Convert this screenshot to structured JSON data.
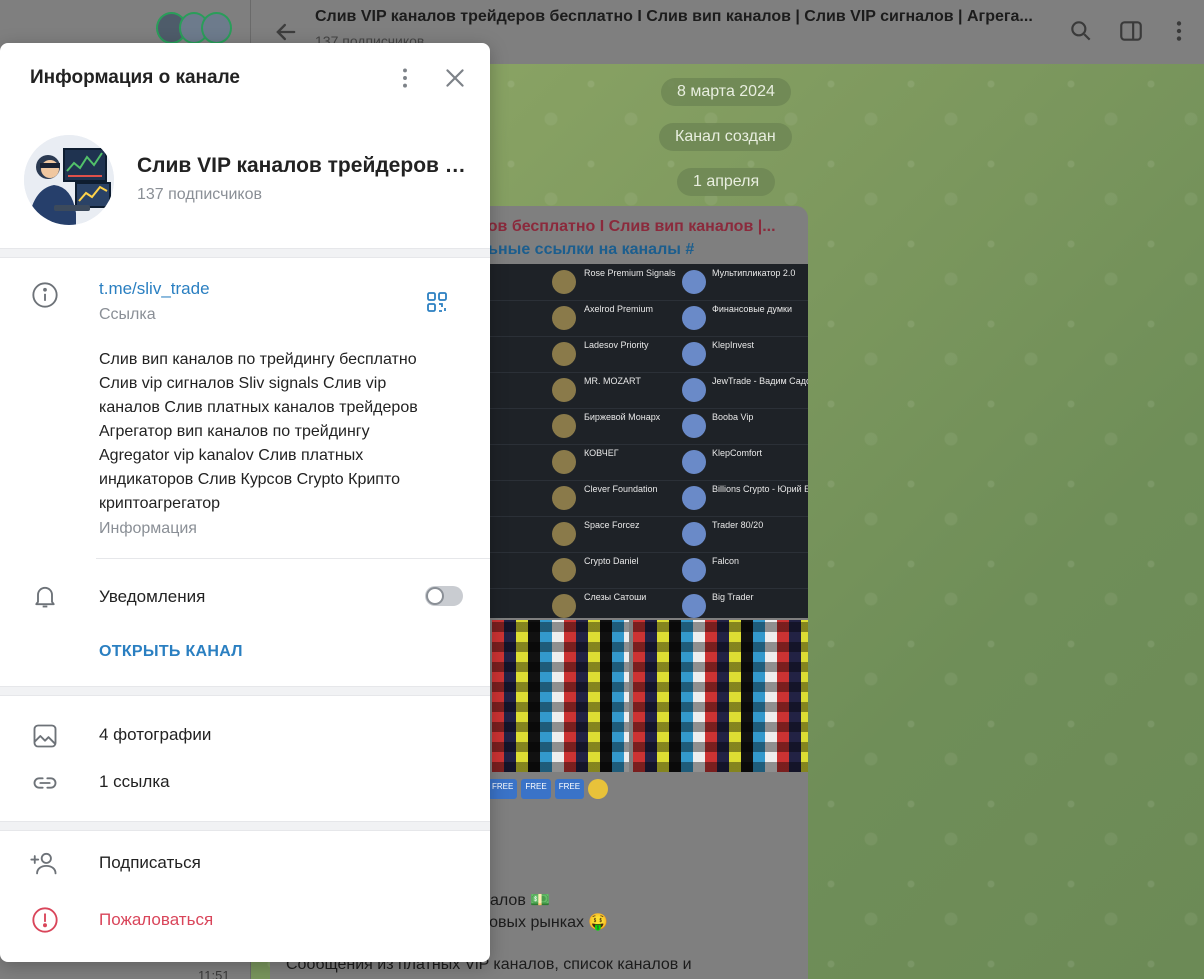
{
  "chat": {
    "title": "Слив VIP каналов трейдеров бесплатно I Слив вип каналов | Слив VIP сигналов | Агрега...",
    "subtitle": "137 подписчиков",
    "dates": [
      "8 марта 2024",
      "Канал создан",
      "1 апреля"
    ],
    "message": {
      "header_line1": "ров бесплатно I Слив вип каналов |...",
      "header_line2": "льные ссылки на каналы #",
      "tags": [
        "FREE",
        "FREE",
        "FREE"
      ],
      "lines": [
        "алов 💵",
        "товых рынках 🤑",
        "Сообщения из платных ViP каналов, список каналов и"
      ]
    },
    "screenshot_rows": [
      {
        "left": "Rose Premium Signals",
        "right": "Мультипликатор 2.0"
      },
      {
        "left": "Axelrod Premium",
        "right": "Финансовые думки"
      },
      {
        "left": "Ladesov Priority",
        "right": "KlepInvest"
      },
      {
        "left": "MR. MOZART",
        "right": "JewTrade - Вадим Садо"
      },
      {
        "left": "Биржевой Монарх",
        "right": "Booba Vip"
      },
      {
        "left": "КОВЧЕГ",
        "right": "KlepComfort"
      },
      {
        "left": "Clever Foundation",
        "right": "Billions Crypto - Юрий Б"
      },
      {
        "left": "Space Forcez",
        "right": "Trader 80/20"
      },
      {
        "left": "Crypto Daniel",
        "right": "Falcon"
      },
      {
        "left": "Слезы Сатоши",
        "right": "Big Trader"
      }
    ],
    "left_time": "11:51"
  },
  "dialog": {
    "title": "Информация о канале",
    "channel_name": "Слив VIP каналов трейдеров б...",
    "subscribers": "137 подписчиков",
    "link": "t.me/sliv_trade",
    "link_caption": "Ссылка",
    "description": "Слив вип каналов по трейдингу бесплатно\nСлив vip сигналов Sliv signals Слив vip\nканалов Слив платных каналов трейдеров\nАгрегатор вип каналов по трейдингу\nAgregator vip  kanalov Слив платных\nиндикаторов Слив Курсов Crypto Крипто\nкриптоагрегатор",
    "description_caption": "Информация",
    "notifications_label": "Уведомления",
    "notifications_enabled": false,
    "open_channel_label": "ОТКРЫТЬ КАНАЛ",
    "photos_label": "4 фотографии",
    "links_label": "1 ссылка",
    "subscribe_label": "Подписаться",
    "report_label": "Пожаловаться"
  },
  "colors": {
    "accent": "#2a7fc1",
    "danger": "#d9455a",
    "muted_text": "#8a8f96"
  },
  "icons": [
    "back-arrow-icon",
    "search-icon",
    "side-panel-icon",
    "more-vertical-icon",
    "close-icon",
    "info-icon",
    "qr-code-icon",
    "bell-icon",
    "photo-icon",
    "link-icon",
    "add-user-icon",
    "report-icon"
  ]
}
